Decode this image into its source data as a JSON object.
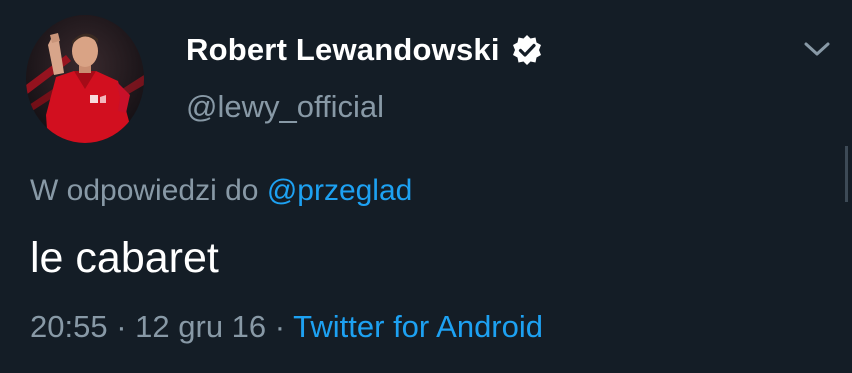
{
  "user": {
    "display_name": "Robert Lewandowski",
    "handle": "@lewy_official",
    "verified": true,
    "avatar": "profile-photo"
  },
  "reply": {
    "prefix": "W odpowiedzi do",
    "mention": "@przeglad"
  },
  "tweet": {
    "text": "le cabaret"
  },
  "meta": {
    "time": "20:55",
    "separator": "·",
    "date": "12 gru 16",
    "source": "Twitter for Android"
  },
  "icons": {
    "verified": "verified-badge-icon",
    "caret": "chevron-down-icon"
  },
  "colors": {
    "background": "#141d26",
    "primary_text": "#ffffff",
    "secondary_text": "#8899a6",
    "link": "#1da1f2"
  }
}
